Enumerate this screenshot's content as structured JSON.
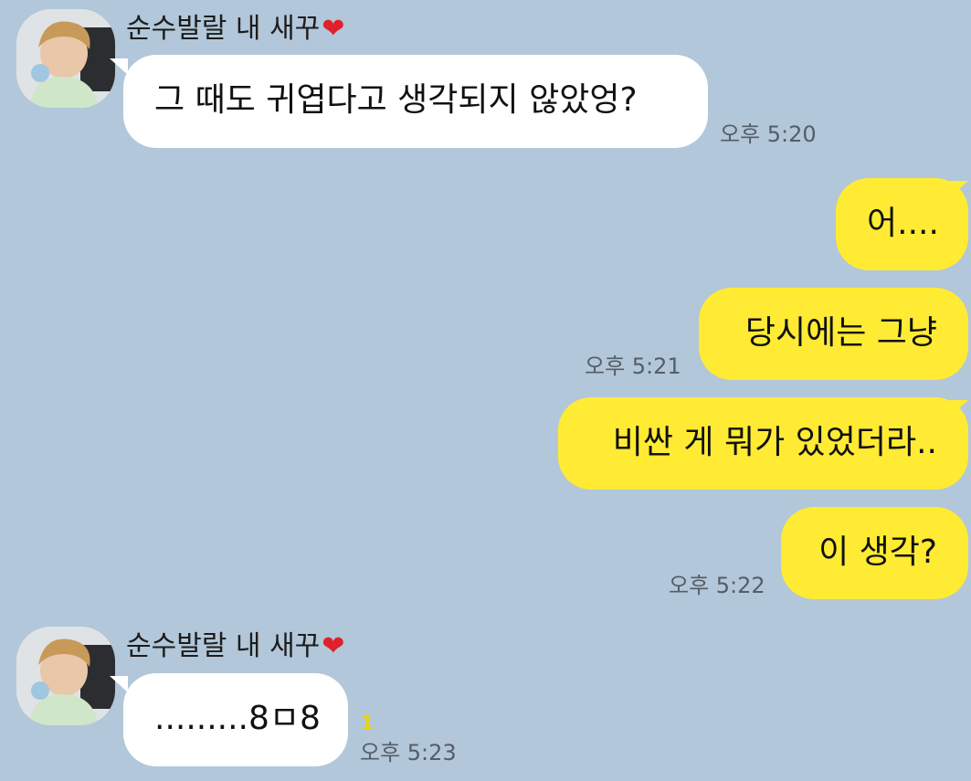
{
  "colors": {
    "background": "#b2c7d9",
    "incoming_bubble": "#ffffff",
    "outgoing_bubble": "#ffeb33",
    "timestamp": "#555d66",
    "unread": "#e8d21a",
    "heart": "#e0202a"
  },
  "contact": {
    "name": "순수발랄 내 새꾸",
    "name_icon": "heart-icon",
    "heart_glyph": "❤"
  },
  "messages": [
    {
      "direction": "incoming",
      "text": "그 때도 귀엽다고 생각되지 않았엉?",
      "time": "오후 5:20"
    },
    {
      "direction": "outgoing",
      "text": "어...."
    },
    {
      "direction": "outgoing",
      "text": "당시에는 그냥",
      "time": "오후 5:21"
    },
    {
      "direction": "outgoing",
      "text": "비싼 게 뭐가 있었더라.."
    },
    {
      "direction": "outgoing",
      "text": "이 생각?",
      "time": "오후 5:22"
    },
    {
      "direction": "incoming",
      "text": ".........8ㅁ8",
      "time": "오후 5:23",
      "unread": "1"
    }
  ]
}
